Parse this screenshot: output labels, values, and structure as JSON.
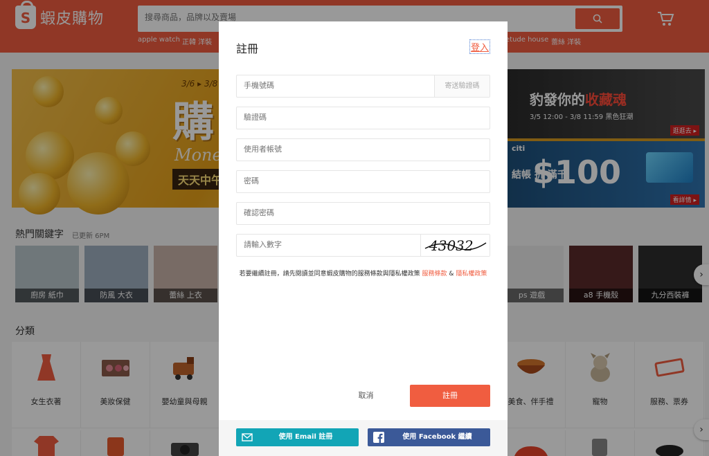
{
  "header": {
    "logo_text": "蝦皮購物",
    "search_placeholder": "搜尋商品，品牌以及賣場",
    "hot_links": [
      "apple watch",
      "正韓 洋裝",
      "etude house",
      "蕾絲 洋裝"
    ]
  },
  "banner": {
    "main_big": "購",
    "main_money": "Money",
    "main_daily": "天天中午",
    "main_date": "3/6 ▸ 3/8",
    "side_top_title_a": "豹發你的",
    "side_top_title_b": "收藏魂",
    "side_top_sub": "3/5 12:00 - 3/8 11:59 黑色狂潮",
    "side_top_tag": "逛逛去 ▸",
    "side_bot_brand": "citi",
    "side_bot_amount": "$100",
    "side_bot_label": "結帳 折 滿千",
    "side_bot_tag": "看詳情 ▸"
  },
  "keywords": {
    "title": "熱門關鍵字",
    "updated": "已更新 6PM",
    "items": [
      "廚房 紙巾",
      "防風 大衣",
      "蕾絲 上衣",
      "ps 遊戲",
      "a8 手機殼",
      "九分西裝褲"
    ]
  },
  "categories": {
    "title": "分類",
    "items": [
      "女生衣著",
      "美妝保健",
      "嬰幼童與母親",
      "美食、伴手禮",
      "寵物",
      "服務、票券"
    ]
  },
  "modal": {
    "title": "註冊",
    "login_link": "登入",
    "phone_placeholder": "手機號碼",
    "send_code_label": "寄送驗證碼",
    "code_placeholder": "驗證碼",
    "username_placeholder": "使用者帳號",
    "password_placeholder": "密碼",
    "confirm_placeholder": "確認密碼",
    "captcha_placeholder": "請輸入數字",
    "captcha_text": "43032",
    "terms_prefix": "若要繼續註冊，請先閱讀並同意蝦皮購物的服務條款與隱私權政策",
    "terms_link1": "服務條款",
    "terms_amp": "&",
    "terms_link2": "隱私權政策",
    "cancel_label": "取消",
    "register_label": "註冊",
    "email_label": "使用 Email 註冊",
    "facebook_label": "使用 Facebook 繼續"
  },
  "colors": {
    "brand": "#f05d40",
    "email": "#12a5b6",
    "facebook": "#3b5998"
  }
}
